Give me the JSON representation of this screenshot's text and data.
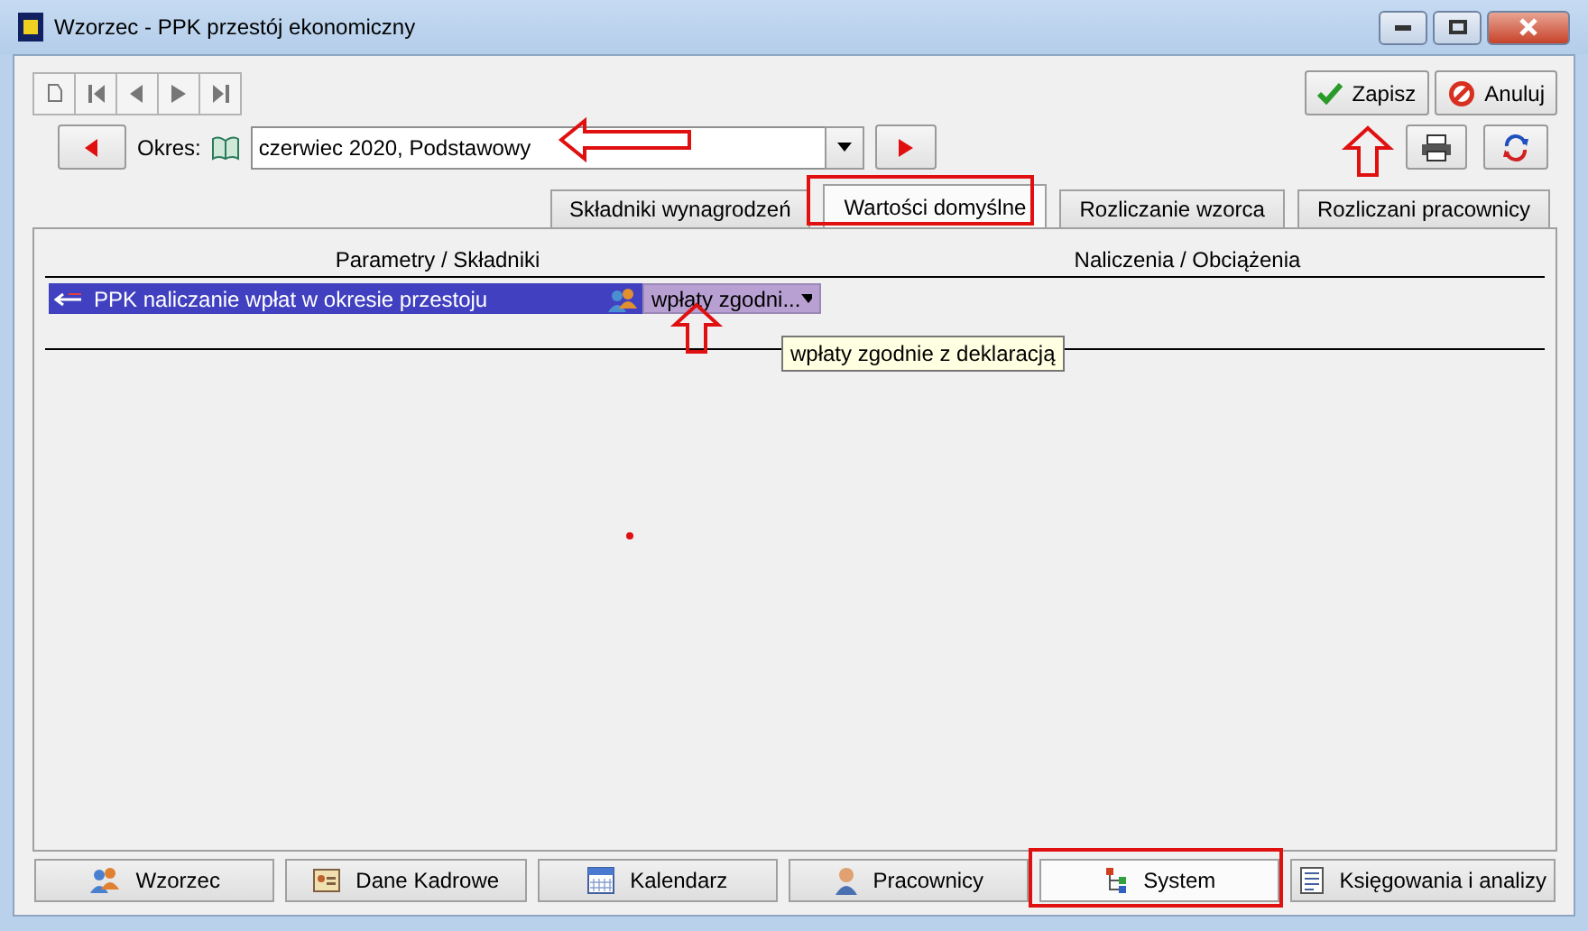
{
  "window": {
    "title": "Wzorzec - PPK przestój ekonomiczny"
  },
  "period": {
    "label": "Okres:",
    "value": "czerwiec 2020, Podstawowy"
  },
  "actions": [
    {
      "label": "Zapisz",
      "kind": "save"
    },
    {
      "label": "Anuluj",
      "kind": "cancel"
    }
  ],
  "tabs": [
    {
      "label": "Składniki wynagrodzeń",
      "selected": false
    },
    {
      "label": "Wartości domyślne",
      "selected": true
    },
    {
      "label": "Rozliczanie wzorca",
      "selected": false
    },
    {
      "label": "Rozliczani pracownicy",
      "selected": false
    }
  ],
  "table": {
    "columns": [
      "Parametry / Składniki",
      "Naliczenia / Obciążenia"
    ],
    "rows": [
      {
        "name": "PPK naliczanie wpłat w okresie przestoju",
        "value": "wpłaty zgodni...",
        "selected": true
      }
    ]
  },
  "tooltip": "wpłaty zgodnie z deklaracją",
  "bottom_tabs": [
    {
      "label": "Wzorzec",
      "kind": "people",
      "selected": false
    },
    {
      "label": "Dane Kadrowe",
      "kind": "card",
      "selected": false
    },
    {
      "label": "Kalendarz",
      "kind": "calendar",
      "selected": false
    },
    {
      "label": "Pracownicy",
      "kind": "person",
      "selected": false
    },
    {
      "label": "System",
      "kind": "tree",
      "selected": true
    },
    {
      "label": "Księgowania i analizy",
      "kind": "sheet",
      "selected": false
    }
  ]
}
